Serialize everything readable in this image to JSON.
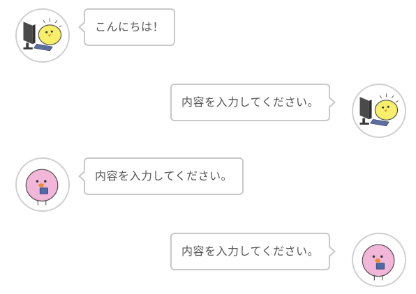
{
  "messages": [
    {
      "side": "left",
      "avatar": "chick-computer-avatar",
      "text": "こんにちは！"
    },
    {
      "side": "right",
      "avatar": "chick-computer-avatar",
      "text": "内容を入力してください。"
    },
    {
      "side": "left",
      "avatar": "pink-bird-avatar",
      "text": "内容を入力してください。"
    },
    {
      "side": "right",
      "avatar": "pink-bird-avatar",
      "text": "内容を入力してください。"
    }
  ],
  "colors": {
    "bubble_border": "#c8c8c8",
    "avatar_border": "#cfcfcf",
    "text": "#555555",
    "chick_yellow": "#f7ef6a",
    "pink_bird": "#f2b6d9",
    "monitor": "#4a4a4a"
  }
}
